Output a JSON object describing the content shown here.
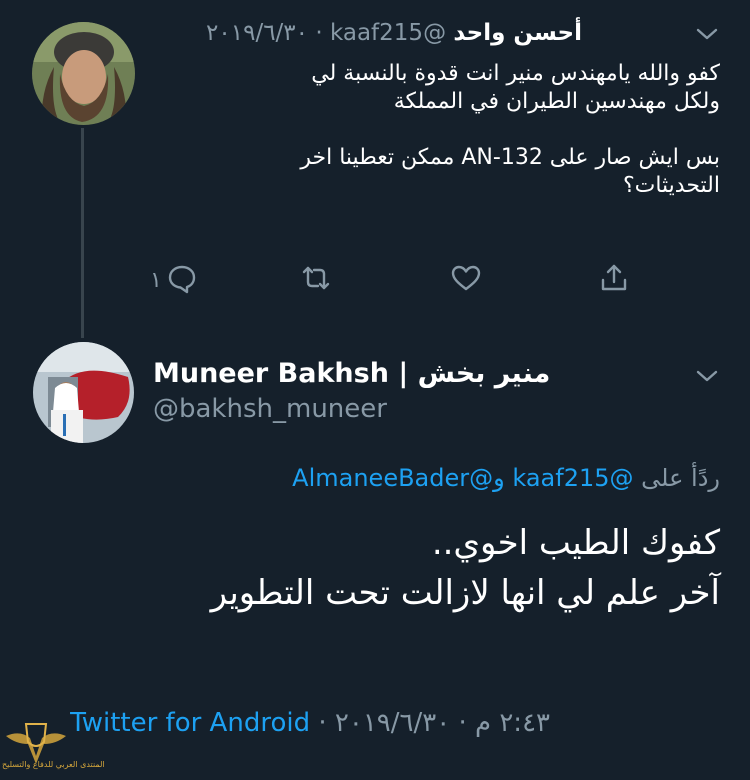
{
  "reply_tweet": {
    "display_name": "أحسن واحد",
    "handle": "@kaaf215",
    "date": "٢٠١٩/٦/٣٠",
    "separator": "·",
    "body": "كفو والله يامهندس منير انت قدوة بالنسبة لي\nولكل مهندسين الطيران في المملكة\n\nبس ايش صار على AN-132 ممكن تعطينا اخر\nالتحديثات؟",
    "reply_count": "١",
    "icons": [
      "reply-icon",
      "retweet-icon",
      "like-icon",
      "share-icon",
      "chevron-down-icon"
    ]
  },
  "main_tweet": {
    "display_name": "Muneer Bakhsh | منير بخش",
    "handle": "@bakhsh_muneer",
    "replying_prefix": "ردًأ على",
    "replying_handle_1": "@kaaf215",
    "replying_conjunction": "و",
    "replying_handle_2": "@AlmaneeBader",
    "text": "كفوك الطيب اخوي..\nآخر علم لي انها لازالت تحت التطوير",
    "time": "٢:٤٣ م",
    "date": "٢٠١٩/٦/٣٠",
    "source": "Twitter for Android",
    "separator": "·"
  },
  "watermark": {
    "text": "المنتدى العربي للدفاع والتسليح"
  },
  "colors": {
    "background": "#15202b",
    "text": "#ffffff",
    "muted": "#8899a6",
    "link": "#1da1f2",
    "divider": "#38444d"
  }
}
